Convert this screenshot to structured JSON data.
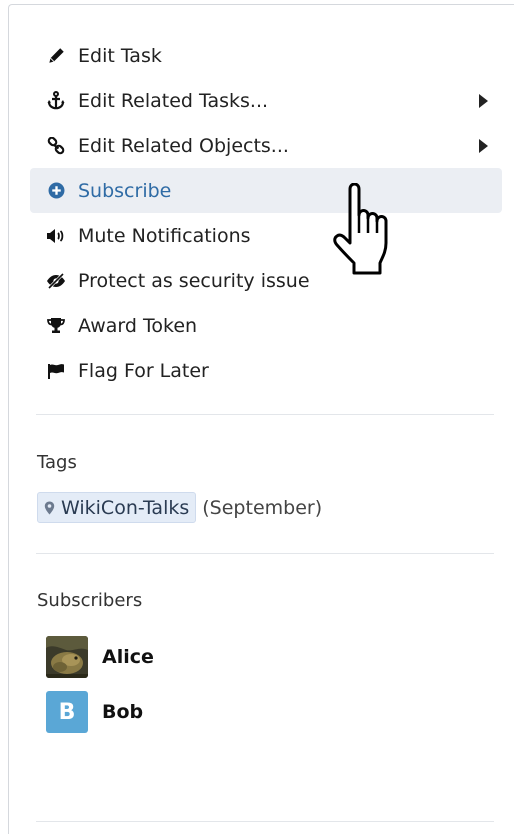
{
  "actions": [
    {
      "label": "Edit Task",
      "icon": "pencil-icon",
      "submenu": false
    },
    {
      "label": "Edit Related Tasks...",
      "icon": "anchor-icon",
      "submenu": true
    },
    {
      "label": "Edit Related Objects...",
      "icon": "link-icon",
      "submenu": true
    },
    {
      "label": "Subscribe",
      "icon": "plus-circle-icon",
      "submenu": false,
      "hovered": true
    },
    {
      "label": "Mute Notifications",
      "icon": "volume-icon",
      "submenu": false
    },
    {
      "label": "Protect as security issue",
      "icon": "eye-slash-icon",
      "submenu": false
    },
    {
      "label": "Award Token",
      "icon": "trophy-icon",
      "submenu": false
    },
    {
      "label": "Flag For Later",
      "icon": "flag-icon",
      "submenu": false
    }
  ],
  "tags": {
    "title": "Tags",
    "items": [
      {
        "name": "WikiCon-Talks",
        "suffix": "(September)",
        "icon": "map-pin-icon"
      }
    ]
  },
  "subscribers": {
    "title": "Subscribers",
    "items": [
      {
        "name": "Alice",
        "avatar": "photo"
      },
      {
        "name": "Bob",
        "avatar": "letter",
        "initial": "B"
      }
    ]
  },
  "colors": {
    "hover_background": "#ebeef3",
    "hover_text": "#2f6ba5",
    "tag_background": "#e4ecf7",
    "avatar_letter_background": "#5aa7d6"
  }
}
